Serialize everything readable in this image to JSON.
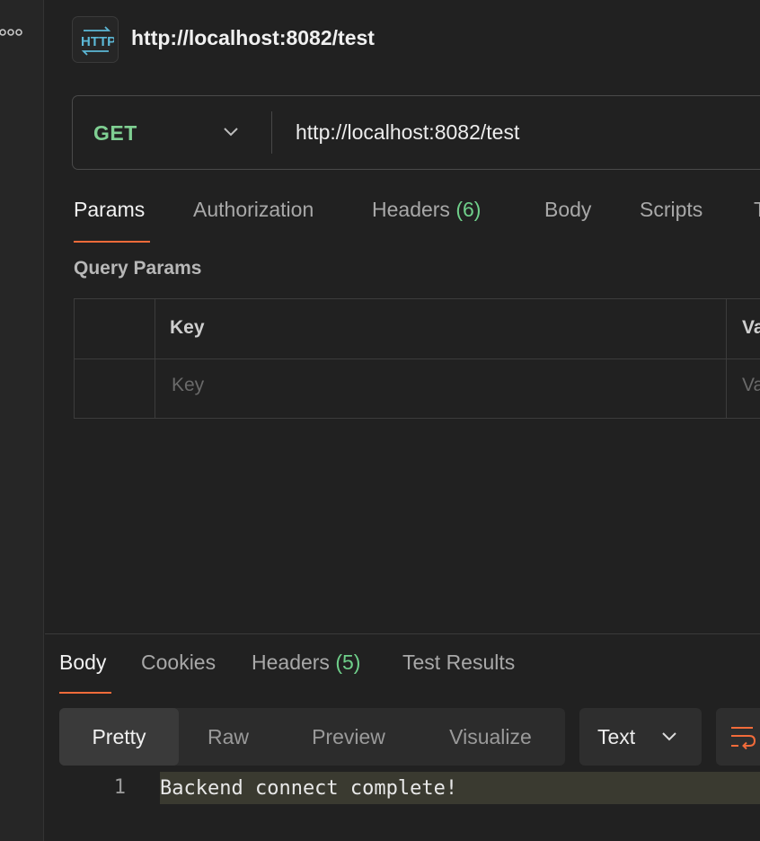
{
  "request": {
    "title": "http://localhost:8082/test",
    "method": "GET",
    "url": "http://localhost:8082/test"
  },
  "request_tabs": [
    {
      "label": "Params",
      "count": "",
      "active": true
    },
    {
      "label": "Authorization",
      "count": "",
      "active": false
    },
    {
      "label": "Headers",
      "count": "(6)",
      "active": false
    },
    {
      "label": "Body",
      "count": "",
      "active": false
    },
    {
      "label": "Scripts",
      "count": "",
      "active": false
    },
    {
      "label": "T",
      "count": "",
      "active": false
    }
  ],
  "query_params": {
    "section_title": "Query Params",
    "columns": [
      "Key",
      "Va"
    ],
    "placeholders": [
      "Key",
      "Va"
    ]
  },
  "response_tabs": [
    {
      "label": "Body",
      "count": "",
      "active": true
    },
    {
      "label": "Cookies",
      "count": "",
      "active": false
    },
    {
      "label": "Headers",
      "count": "(5)",
      "active": false
    },
    {
      "label": "Test Results",
      "count": "",
      "active": false
    }
  ],
  "view_modes": [
    "Pretty",
    "Raw",
    "Preview",
    "Visualize"
  ],
  "active_view": "Pretty",
  "format": "Text",
  "response_body": {
    "line_number": "1",
    "text": "Backend connect complete!"
  },
  "colors": {
    "method": "#7fcf92",
    "accent": "#f26b3a",
    "count": "#6fcf8a"
  },
  "icons": [
    "more-icon",
    "http-icon",
    "chevron-down-icon",
    "wrap-lines-icon"
  ]
}
